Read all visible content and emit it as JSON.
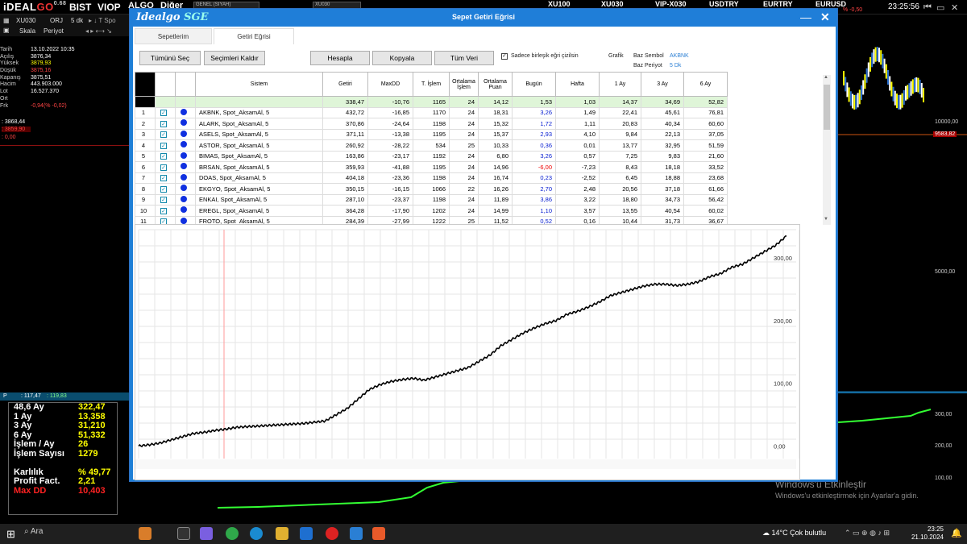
{
  "topbar": {
    "logo_text": "iDEALGO",
    "version": "0.68",
    "menu": [
      "BIST",
      "VIOP",
      "ALGO",
      "Diğer"
    ],
    "tickers": [
      "XU100",
      "XU030",
      "VIP-X030",
      "USDTRY",
      "EURTRY",
      "EURUSD"
    ],
    "neg_pct": "% -0,50",
    "time": "23:25:56",
    "account_field": "GENEL (SIYAH)",
    "symbol_field": "XU030"
  },
  "symbol_bar": {
    "symbol": "XU030",
    "orj": "ORJ",
    "period": "5 dk",
    "scale": "Skala",
    "period_label": "Periyot"
  },
  "info_panel": [
    {
      "k": "Tarih",
      "v": "13.10.2022 10:35",
      "color": "#fff"
    },
    {
      "k": "Açılış",
      "v": "3876,34",
      "color": "#fff"
    },
    {
      "k": "Yüksek",
      "v": "3879,93",
      "color": "#ff0"
    },
    {
      "k": "Düşük",
      "v": "3875,16",
      "color": "#f44"
    },
    {
      "k": "Kapanış",
      "v": "3875,51",
      "color": "#fff"
    },
    {
      "k": "Hacim",
      "v": "443.903.000",
      "color": "#fff"
    },
    {
      "k": "Lot",
      "v": "16.527.370",
      "color": "#fff"
    },
    {
      "k": "Ort",
      "v": "",
      "color": "#fff"
    },
    {
      "k": "Frk",
      "v": "-0,94(% -0,02)",
      "color": "#f44"
    }
  ],
  "levels": {
    "a": ": 3868,44",
    "b": ": 3859,90",
    "c": ": 0,00"
  },
  "p_bar": {
    "p": "P",
    "v1": ": 117,47",
    "v2": ": 119,83"
  },
  "stats": [
    {
      "k": "48,6 Ay",
      "v": "322,47",
      "kc": "#fff",
      "vc": "#ff0"
    },
    {
      "k": "1 Ay",
      "v": "13,358",
      "kc": "#fff",
      "vc": "#ff0"
    },
    {
      "k": "3 Ay",
      "v": "31,210",
      "kc": "#fff",
      "vc": "#ff0"
    },
    {
      "k": "6 Ay",
      "v": "51,332",
      "kc": "#fff",
      "vc": "#ff0"
    },
    {
      "k": "İşlem / Ay",
      "v": "26",
      "kc": "#fff",
      "vc": "#ff0"
    },
    {
      "k": "İşlem Sayısı",
      "v": "1279",
      "kc": "#fff",
      "vc": "#ff0"
    },
    {
      "k": "",
      "v": "",
      "kc": "#fff",
      "vc": "#ff0"
    },
    {
      "k": "Karlılık",
      "v": "% 49,77",
      "kc": "#fff",
      "vc": "#ff0"
    },
    {
      "k": "Profit Fact.",
      "v": "2,21",
      "kc": "#fff",
      "vc": "#ff0"
    },
    {
      "k": "Max DD",
      "v": "10,403",
      "kc": "#f22",
      "vc": "#f22"
    }
  ],
  "right_labels": {
    "a": "10000,00",
    "b": "9583,82",
    "c": "5000,00",
    "d": "300,00",
    "e": "200,00",
    "f": "100,00"
  },
  "dialog": {
    "brand": "Idealgo",
    "brand_sge": "SGE",
    "title": "Sepet Getiri Eğrisi",
    "tabs": [
      "Sepetlerim",
      "Getiri Eğrisi"
    ],
    "buttons": {
      "select_all": "Tümünü Seç",
      "clear": "Seçimleri Kaldır",
      "calc": "Hesapla",
      "copy": "Kopyala",
      "all_data": "Tüm Veri"
    },
    "checkbox_label": "Sadece birleşik eğri çizilsin",
    "grafik": "Grafik",
    "base_symbol_label": "Baz Sembol",
    "base_symbol": "AKBNK",
    "base_period_label": "Baz Periyot",
    "base_period": "5 Dk"
  },
  "table": {
    "headers": [
      "",
      "",
      "",
      "Sistem",
      "Getiri",
      "MaxDD",
      "T. İşlem",
      "Ortalama İşlem",
      "Ortalama Puan",
      "Bugün",
      "Hafta",
      "1 Ay",
      "3 Ay",
      "6 Ay"
    ],
    "total": [
      "",
      "",
      "",
      "",
      "338,47",
      "-10,76",
      "1165",
      "24",
      "14,12",
      "1,53",
      "1,03",
      "14,37",
      "34,69",
      "52,82"
    ],
    "rows": [
      [
        "1",
        "AKBNK, Spot_AksamAl, 5",
        "432,72",
        "-16,85",
        "1170",
        "24",
        "18,31",
        "3,26",
        "1,49",
        "22,41",
        "45,61",
        "76,81"
      ],
      [
        "2",
        "ALARK, Spot_AksamAl, 5",
        "370,86",
        "-24,64",
        "1198",
        "24",
        "15,32",
        "1,72",
        "1,11",
        "20,83",
        "40,34",
        "60,60"
      ],
      [
        "3",
        "ASELS, Spot_AksamAl, 5",
        "371,11",
        "-13,38",
        "1195",
        "24",
        "15,37",
        "2,93",
        "4,10",
        "9,84",
        "22,13",
        "37,05"
      ],
      [
        "4",
        "ASTOR, Spot_AksamAl, 5",
        "260,92",
        "-28,22",
        "534",
        "25",
        "10,33",
        "0,36",
        "0,01",
        "13,77",
        "32,95",
        "51,59"
      ],
      [
        "5",
        "BIMAS, Spot_AksamAl, 5",
        "163,86",
        "-23,17",
        "1192",
        "24",
        "6,80",
        "3,26",
        "0,57",
        "7,25",
        "9,83",
        "21,60"
      ],
      [
        "6",
        "BRSAN, Spot_AksamAl, 5",
        "359,93",
        "-41,88",
        "1195",
        "24",
        "14,96",
        "-6,00",
        "-7,23",
        "8,43",
        "18,18",
        "33,52"
      ],
      [
        "7",
        "DOAS, Spot_AksamAl, 5",
        "404,18",
        "-23,36",
        "1198",
        "24",
        "16,74",
        "0,23",
        "-2,52",
        "6,45",
        "18,88",
        "23,68"
      ],
      [
        "8",
        "EKGYO, Spot_AksamAl, 5",
        "350,15",
        "-16,15",
        "1066",
        "22",
        "16,26",
        "2,70",
        "2,48",
        "20,56",
        "37,18",
        "61,66"
      ],
      [
        "9",
        "ENKAI, Spot_AksamAl, 5",
        "287,10",
        "-23,37",
        "1198",
        "24",
        "11,89",
        "3,86",
        "3,22",
        "18,80",
        "34,73",
        "56,42"
      ],
      [
        "10",
        "EREGL, Spot_AksamAl, 5",
        "364,28",
        "-17,90",
        "1202",
        "24",
        "14,99",
        "1,10",
        "3,57",
        "13,55",
        "40,54",
        "60,02"
      ],
      [
        "11",
        "FROTO, Spot_AksamAl, 5",
        "284,39",
        "-27,99",
        "1222",
        "25",
        "11,52",
        "0,52",
        "0,16",
        "10,44",
        "31,73",
        "36,67"
      ]
    ]
  },
  "chart_data": {
    "type": "line",
    "y_ticks": [
      "0,00",
      "100,00",
      "200,00",
      "300,00"
    ],
    "ylim": [
      -20,
      345
    ],
    "grid": true,
    "series": [
      {
        "values": [
          0,
          2,
          5,
          10,
          15,
          20,
          22,
          25,
          27,
          30,
          31,
          32,
          33,
          34,
          35,
          36,
          38,
          40,
          50,
          60,
          75,
          90,
          98,
          103,
          106,
          108,
          105,
          110,
          115,
          120,
          125,
          135,
          145,
          160,
          170,
          180,
          188,
          195,
          200,
          210,
          215,
          222,
          230,
          240,
          245,
          250,
          255,
          258,
          258,
          256,
          258,
          262,
          270,
          275,
          285,
          290,
          300,
          310,
          320,
          335
        ]
      }
    ],
    "x_ticks_note": ""
  },
  "watermark": {
    "line1": "Windows'u Etkinleştir",
    "line2": "Windows'u etkinleştirmek için Ayarlar'a gidin."
  },
  "taskbar": {
    "search": "Ara",
    "weather": "14°C  Çok bulutlu",
    "time": "23:25",
    "date": "21.10.2024"
  }
}
